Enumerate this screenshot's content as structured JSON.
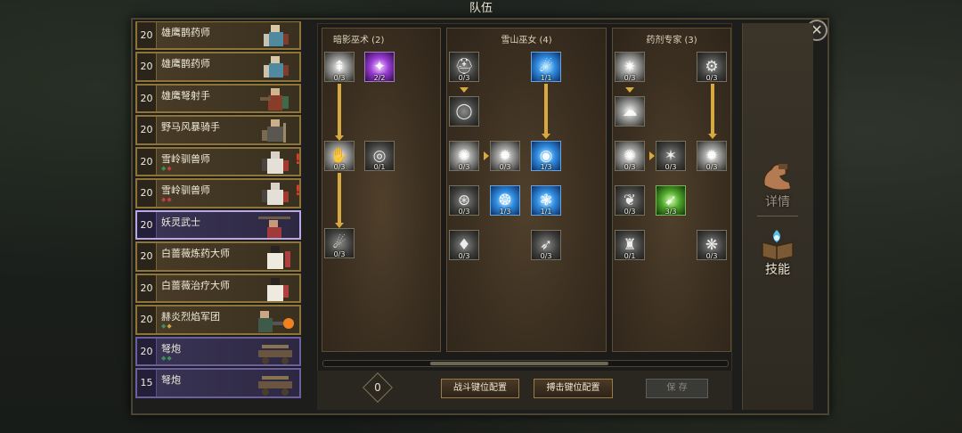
{
  "window": {
    "title": "队伍",
    "close_glyph": "✕"
  },
  "roster": [
    {
      "level": "20",
      "name": "雄鹰鹊药师",
      "style": "gold",
      "gems": []
    },
    {
      "level": "20",
      "name": "雄鹰鹊药师",
      "style": "gold",
      "gems": []
    },
    {
      "level": "20",
      "name": "雄鹰弩射手",
      "style": "gold",
      "gems": []
    },
    {
      "level": "20",
      "name": "野马风暴骑手",
      "style": "gold",
      "gems": []
    },
    {
      "level": "20",
      "name": "雪岭驯兽师",
      "style": "gold",
      "gems": [
        "g",
        "r"
      ],
      "warning": "!"
    },
    {
      "level": "20",
      "name": "雪岭驯兽师",
      "style": "gold",
      "gems": [
        "r",
        "r"
      ],
      "warning": "!"
    },
    {
      "level": "20",
      "name": "妖灵武士",
      "style": "purple",
      "selected": true,
      "gems": []
    },
    {
      "level": "20",
      "name": "白蔷薇炼药大师",
      "style": "gold",
      "gems": []
    },
    {
      "level": "20",
      "name": "白蔷薇治疗大师",
      "style": "gold",
      "gems": []
    },
    {
      "level": "20",
      "name": "赫炎烈焰军团",
      "style": "gold",
      "gems": [
        "g",
        "y"
      ]
    },
    {
      "level": "20",
      "name": "弩炮",
      "style": "purple",
      "gems": [
        "g",
        "g"
      ]
    },
    {
      "level": "15",
      "name": "弩炮",
      "style": "purple",
      "gems": []
    }
  ],
  "trees": [
    {
      "title": "暗影巫术 (2)",
      "skills": [
        {
          "count": "0/3",
          "style": "white",
          "icon": "spire-icon"
        },
        {
          "count": "2/2",
          "style": "purple",
          "icon": "shadow-burst-icon"
        },
        {
          "count": "0/3",
          "style": "white",
          "icon": "claw-icon"
        },
        {
          "count": "0/1",
          "style": "grey",
          "icon": "vortex-icon"
        },
        {
          "count": "0/3",
          "style": "grey",
          "icon": "falling-figure-icon"
        }
      ]
    },
    {
      "title": "雪山巫女 (4)",
      "skills": [
        {
          "count": "0/3",
          "style": "grey",
          "icon": "helm-icon"
        },
        {
          "count": "1/1",
          "style": "blue",
          "icon": "comet-icon"
        },
        {
          "count": "",
          "style": "grey",
          "icon": "ring-icon"
        },
        {
          "count": "0/3",
          "style": "white",
          "icon": "star-eye-icon"
        },
        {
          "count": "0/3",
          "style": "white",
          "icon": "burst-icon"
        },
        {
          "count": "1/3",
          "style": "blue",
          "icon": "frost-orb-icon"
        },
        {
          "count": "0/3",
          "style": "grey",
          "icon": "rune-circle-icon"
        },
        {
          "count": "1/3",
          "style": "blue",
          "icon": "ice-shell-icon"
        },
        {
          "count": "1/1",
          "style": "blue",
          "icon": "frost-flower-icon"
        },
        {
          "count": "0/3",
          "style": "grey",
          "icon": "crystal-icon"
        },
        {
          "count": "0/3",
          "style": "grey",
          "icon": "ice-spear-icon"
        }
      ]
    },
    {
      "title": "药剂专家 (3)",
      "skills": [
        {
          "count": "0/3",
          "style": "white",
          "icon": "flare-icon"
        },
        {
          "count": "0/3",
          "style": "grey",
          "icon": "cage-icon"
        },
        {
          "count": "",
          "style": "white",
          "icon": "mist-icon"
        },
        {
          "count": "0/3",
          "style": "white",
          "icon": "spark-icon"
        },
        {
          "count": "0/3",
          "style": "grey",
          "icon": "blast-icon"
        },
        {
          "count": "0/3",
          "style": "white",
          "icon": "shine-icon"
        },
        {
          "count": "0/3",
          "style": "grey",
          "icon": "leaf-icon"
        },
        {
          "count": "3/3",
          "style": "green",
          "icon": "poison-dart-icon"
        },
        {
          "count": "0/1",
          "style": "grey",
          "icon": "golem-icon"
        },
        {
          "count": "0/3",
          "style": "grey",
          "icon": "aura-icon"
        }
      ]
    }
  ],
  "bottom": {
    "points": "0",
    "combat_keys": "战斗键位配置",
    "capture_keys": "搏击键位配置",
    "save": "保 存"
  },
  "side_tabs": [
    {
      "label": "详情",
      "icon": "arm-icon"
    },
    {
      "label": "技能",
      "icon": "spellbook-icon"
    }
  ]
}
